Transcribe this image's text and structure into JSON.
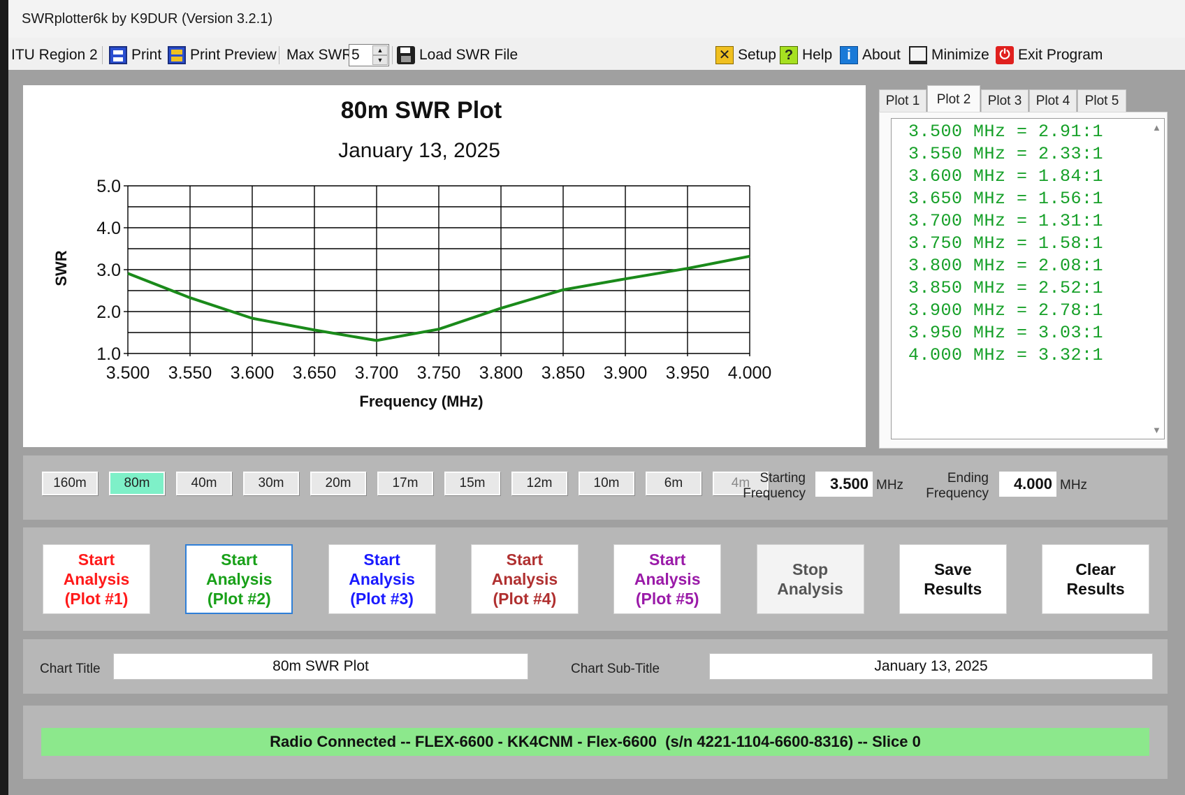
{
  "window": {
    "title": "SWRplotter6k by K9DUR (Version 3.2.1)"
  },
  "toolbar": {
    "region": "ITU Region 2",
    "print": "Print",
    "print_preview": "Print Preview",
    "max_swr_label": "Max SWR",
    "max_swr_value": "5",
    "load_file": "Load SWR File",
    "setup": "Setup",
    "help": "Help",
    "about": "About",
    "minimize": "Minimize",
    "exit": "Exit Program"
  },
  "chart_data": {
    "type": "line",
    "title": "80m SWR Plot",
    "subtitle": "January 13, 2025",
    "xlabel": "Frequency (MHz)",
    "ylabel": "SWR",
    "xlim": [
      3.5,
      4.0
    ],
    "ylim": [
      1.0,
      5.0
    ],
    "x_ticks": [
      "3.500",
      "3.550",
      "3.600",
      "3.650",
      "3.700",
      "3.750",
      "3.800",
      "3.850",
      "3.900",
      "3.950",
      "4.000"
    ],
    "y_ticks": [
      "1.0",
      "2.0",
      "3.0",
      "4.0",
      "5.0"
    ],
    "grid": true,
    "series": [
      {
        "color": "#1a8a1a",
        "x": [
          3.5,
          3.55,
          3.6,
          3.65,
          3.7,
          3.75,
          3.8,
          3.85,
          3.9,
          3.95,
          4.0
        ],
        "y": [
          2.91,
          2.33,
          1.84,
          1.56,
          1.31,
          1.58,
          2.08,
          2.52,
          2.78,
          3.03,
          3.32
        ]
      }
    ]
  },
  "plot_tabs": [
    "Plot 1",
    "Plot 2",
    "Plot 3",
    "Plot 4",
    "Plot 5"
  ],
  "active_tab": "Plot 2",
  "results": [
    "3.500 MHz = 2.91:1",
    "3.550 MHz = 2.33:1",
    "3.600 MHz = 1.84:1",
    "3.650 MHz = 1.56:1",
    "3.700 MHz = 1.31:1",
    "3.750 MHz = 1.58:1",
    "3.800 MHz = 2.08:1",
    "3.850 MHz = 2.52:1",
    "3.900 MHz = 2.78:1",
    "3.950 MHz = 3.03:1",
    "4.000 MHz = 3.32:1"
  ],
  "bands": [
    "160m",
    "80m",
    "40m",
    "30m",
    "20m",
    "17m",
    "15m",
    "12m",
    "10m",
    "6m",
    "4m"
  ],
  "selected_band": "80m",
  "disabled_bands": [
    "4m"
  ],
  "freq": {
    "start_label": "Starting\nFrequency",
    "start_value": "3.500",
    "end_label": "Ending\nFrequency",
    "end_value": "4.000",
    "unit": "MHz"
  },
  "analysis_buttons": [
    {
      "label": "Start\nAnalysis\n(Plot #1)",
      "color": "#ff1a1a"
    },
    {
      "label": "Start\nAnalysis\n(Plot #2)",
      "color": "#18a018"
    },
    {
      "label": "Start\nAnalysis\n(Plot #3)",
      "color": "#1a1aff"
    },
    {
      "label": "Start\nAnalysis\n(Plot #4)",
      "color": "#b03030"
    },
    {
      "label": "Start\nAnalysis\n(Plot #5)",
      "color": "#9a1aa8"
    },
    {
      "label": "Stop\nAnalysis",
      "color": "#555555"
    },
    {
      "label": "Save\nResults",
      "color": "#111111"
    },
    {
      "label": "Clear\nResults",
      "color": "#111111"
    }
  ],
  "titles": {
    "chart_title_label": "Chart Title",
    "chart_title_value": "80m SWR Plot",
    "chart_subtitle_label": "Chart Sub-Title",
    "chart_subtitle_value": "January 13, 2025"
  },
  "status": "Radio Connected -- FLEX-6600 - KK4CNM - Flex-6600  (s/n 4221-1104-6600-8316) -- Slice 0"
}
